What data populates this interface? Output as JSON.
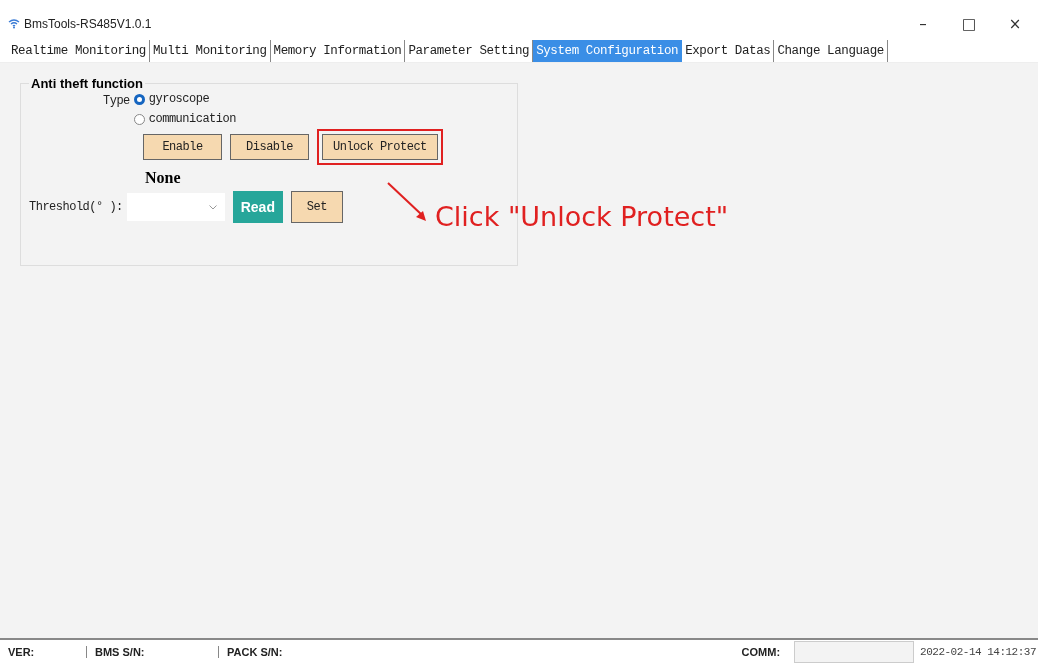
{
  "window": {
    "title": "BmsTools-RS485V1.0.1",
    "controls": [
      "–",
      "□",
      "×"
    ]
  },
  "tabs": [
    {
      "label": "Realtime Monitoring",
      "selected": false
    },
    {
      "label": "Multi Monitoring",
      "selected": false
    },
    {
      "label": "Memory Information",
      "selected": false
    },
    {
      "label": "Parameter Setting",
      "selected": false
    },
    {
      "label": "System Configuration",
      "selected": true
    },
    {
      "label": "Export Datas",
      "selected": false
    },
    {
      "label": "Change Language",
      "selected": false
    }
  ],
  "anti_theft": {
    "title": "Anti theft function",
    "type_label": "Type",
    "types": [
      {
        "label": "gyroscope",
        "selected": true
      },
      {
        "label": "communication",
        "selected": false
      }
    ],
    "buttons": [
      {
        "label": "Enable",
        "highlighted": false
      },
      {
        "label": "Disable",
        "highlighted": false
      },
      {
        "label": "Unlock Protect",
        "highlighted": true
      }
    ],
    "status": "None",
    "threshold_label": "Threshold(° ):",
    "read_button": "Read",
    "set_button": "Set"
  },
  "annotation": "Click \"Unlock Protect\"",
  "status_bar": {
    "ver": "VER:",
    "bms_sn": "BMS S/N:",
    "pack_sn": "PACK S/N:",
    "comm": "COMM:",
    "time": "2022-02-14 14:12:37"
  }
}
